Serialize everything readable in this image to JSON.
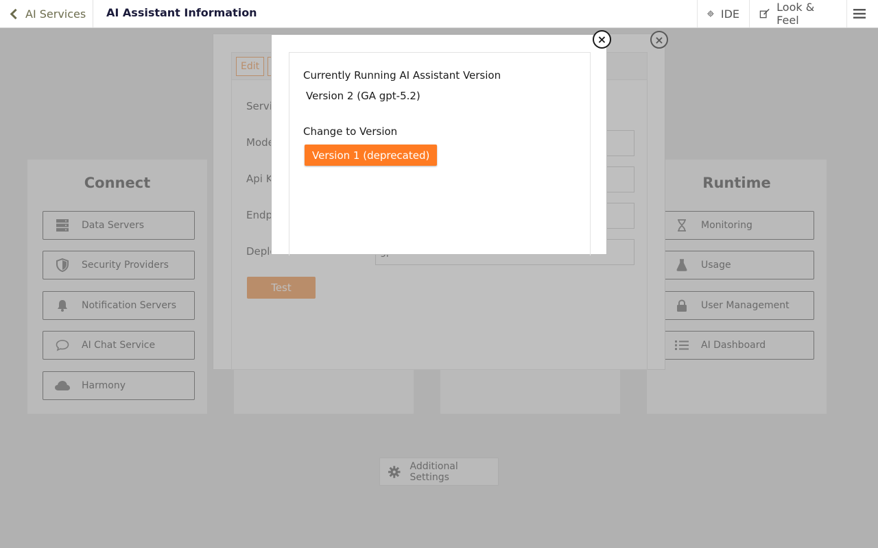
{
  "header": {
    "back_label": "AI Services",
    "title": "AI Assistant Information",
    "ide_label": "IDE",
    "look_feel_label": "Look & Feel"
  },
  "cards": {
    "connect": {
      "title": "Connect",
      "items": [
        {
          "label": "Data Servers",
          "icon": "server-icon"
        },
        {
          "label": "Security Providers",
          "icon": "shield-icon"
        },
        {
          "label": "Notification Servers",
          "icon": "bell-icon"
        },
        {
          "label": "AI Chat Service",
          "icon": "chat-icon"
        },
        {
          "label": "Harmony",
          "icon": "cloud-icon"
        }
      ]
    },
    "runtime": {
      "title": "Runtime",
      "items": [
        {
          "label": "Monitoring",
          "icon": "hourglass-icon"
        },
        {
          "label": "Usage",
          "icon": "flask-icon"
        },
        {
          "label": "User Management",
          "icon": "lock-icon"
        },
        {
          "label": "AI Dashboard",
          "icon": "list-icon"
        }
      ]
    }
  },
  "dialog": {
    "edit_tab": "Edit",
    "labels": [
      "Servic",
      "Mode",
      "Api K",
      "Endp",
      "Deplo"
    ],
    "deployment_value": "gpt-5.2",
    "test_label": "Test",
    "close_glyph": "×"
  },
  "additional_settings": "Additional Settings",
  "version_modal": {
    "current_heading": "Currently Running AI Assistant Version",
    "current_version": "Version 2 (GA gpt-5.2)",
    "change_heading": "Change to Version",
    "option_label": "Version 1 (deprecated)",
    "close_glyph": "×"
  },
  "colors": {
    "accent": "#ff7b22",
    "accent_muted": "#f39a55",
    "back_link": "#6d6d4e"
  }
}
